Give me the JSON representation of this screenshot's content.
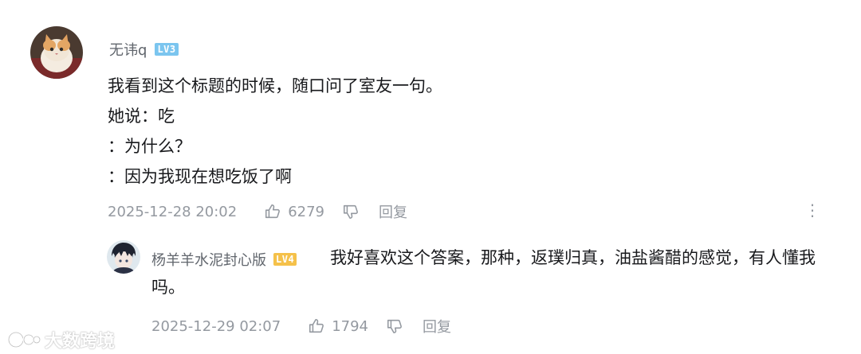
{
  "comment": {
    "username": "无讳q",
    "level": "LV3",
    "lines": [
      "我看到这个标题的时候，随口问了室友一句。",
      "她说：吃",
      "：为什么？",
      "：因为我现在想吃饭了啊"
    ],
    "timestamp": "2025-12-28 20:02",
    "likes": "6279",
    "reply_label": "回复",
    "more_label": "⋮"
  },
  "reply": {
    "username": "杨羊羊水泥封心版",
    "level": "LV4",
    "text": "我好喜欢这个答案，那种，返璞归真，油盐酱醋的感觉，有人懂我吗。",
    "timestamp": "2025-12-29 02:07",
    "likes": "1794",
    "reply_label": "回复"
  },
  "watermark": "大数跨境",
  "icons": [
    "thumb-up-icon",
    "thumb-down-icon",
    "more-vertical-icon",
    "cat-avatar",
    "anime-avatar"
  ],
  "colors": {
    "meta": "#9499a0",
    "username": "#61666d",
    "lv3": "#7bc5ef",
    "lv4": "#f5c14a"
  }
}
